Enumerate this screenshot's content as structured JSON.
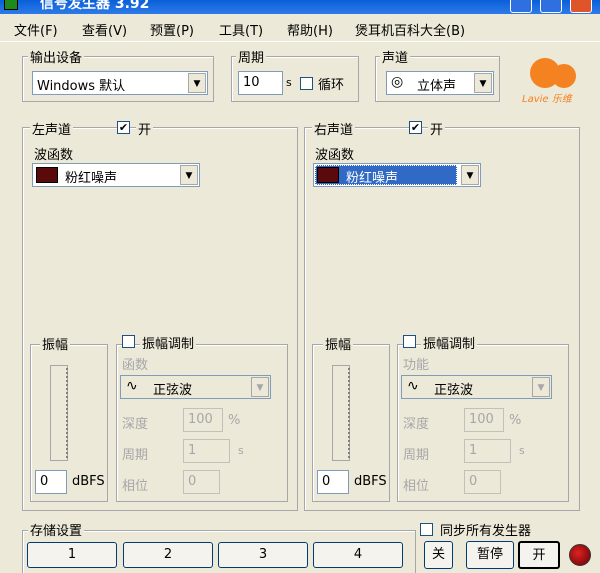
{
  "window": {
    "title": "信号发生器 3.92"
  },
  "menu": [
    "文件(F)",
    "查看(V)",
    "预置(P)",
    "工具(T)",
    "帮助(H)",
    "煲耳机百科大全(B)"
  ],
  "output": {
    "legend": "输出设备",
    "device": "Windows 默认"
  },
  "period": {
    "legend": "周期",
    "value": "10",
    "unit": "s",
    "loop_label": "循环"
  },
  "channel_mode": {
    "legend": "声道",
    "value": "立体声"
  },
  "logo": {
    "text": "Lavie 乐维"
  },
  "left": {
    "legend": "左声道",
    "enable_label": "开",
    "enable_mark": "✔",
    "wave_label": "波函数",
    "wave_value": "粉红噪声",
    "amp_legend": "振幅",
    "amp_value": "0",
    "amp_unit": "dBFS",
    "mod_label": "振幅调制",
    "func_label": "函数",
    "func_value": "正弦波",
    "depth_label": "深度",
    "depth_value": "100",
    "depth_unit": "%",
    "period_label": "周期",
    "period_value": "1",
    "period_unit": "s",
    "phase_label": "相位",
    "phase_value": "0"
  },
  "right": {
    "legend": "右声道",
    "enable_label": "开",
    "enable_mark": "✔",
    "wave_label": "波函数",
    "wave_value": "粉红噪声",
    "amp_legend": "振幅",
    "amp_value": "0",
    "amp_unit": "dBFS",
    "mod_label": "振幅调制",
    "func_label": "功能",
    "func_value": "正弦波",
    "depth_label": "深度",
    "depth_value": "100",
    "depth_unit": "%",
    "period_label": "周期",
    "period_value": "1",
    "period_unit": "s",
    "phase_label": "相位",
    "phase_value": "0"
  },
  "storage": {
    "legend": "存储设置",
    "slots": [
      "1",
      "2",
      "3",
      "4"
    ]
  },
  "sync": {
    "label": "同步所有发生器"
  },
  "controls": {
    "off": "关",
    "pause": "暂停",
    "on": "开"
  },
  "colors": {
    "title": "#0a5fd8",
    "selection": "#316ac5",
    "logo": "#f58220",
    "led": "#cc2222"
  }
}
